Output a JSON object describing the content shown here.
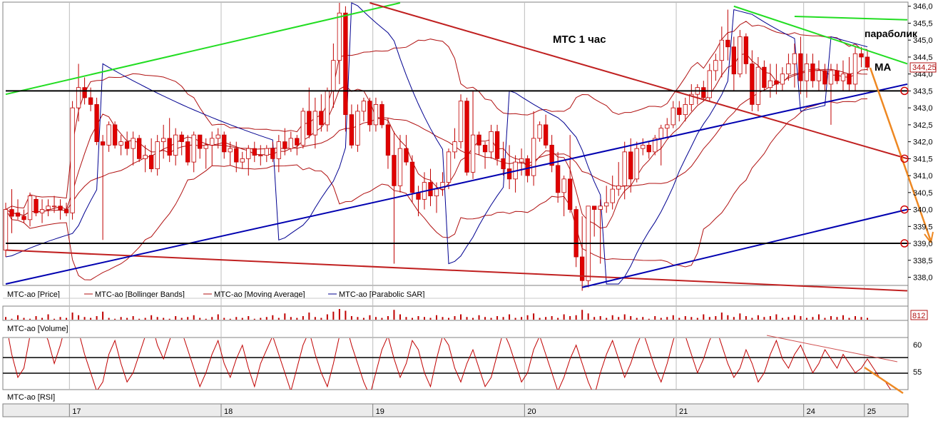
{
  "title": "МТС  1 час",
  "annotations": {
    "parabolic": "параболик",
    "ma": "МА"
  },
  "price_axis": {
    "ticks": [
      "346,0",
      "345,5",
      "345,0",
      "344,5",
      "344,0",
      "343,5",
      "343,0",
      "342,5",
      "342,0",
      "341,5",
      "341,0",
      "340,5",
      "340,0",
      "339,5",
      "339,0",
      "338,5",
      "338,0"
    ],
    "current_label": "344,25"
  },
  "rsi_axis": {
    "ticks": [
      "60",
      "55"
    ]
  },
  "volume_label": "812",
  "legend": {
    "price": "MTC-ao [Price]",
    "bb": "MTC-ao [Bollinger Bands]",
    "ma": "MTC-ao [Moving Average]",
    "sar": "MTC-ao [Parabolic SAR]"
  },
  "panel_labels": {
    "volume": "MTC-ao [Volume]",
    "rsi": "MTC-ao [RSI]"
  },
  "dates": [
    "17",
    "18",
    "19",
    "20",
    "21",
    "24",
    "25"
  ],
  "colors": {
    "bull": "#ffffff",
    "bear": "#e00000",
    "wick": "#c00000",
    "bb": "#b01010",
    "ma": "#b01010",
    "sar": "#000090",
    "green": "#22dd22",
    "red": "#c02020",
    "blue": "#0000b0",
    "orange": "#ee8822"
  },
  "chart_data": {
    "type": "candlestick",
    "title": "МТС  1 час",
    "ylim": [
      337.8,
      346.1
    ],
    "candles": [
      [
        338.8,
        340.2,
        338.6,
        340.0
      ],
      [
        340.0,
        340.6,
        339.3,
        339.8
      ],
      [
        339.9,
        340.3,
        339.7,
        339.8
      ],
      [
        339.8,
        340.0,
        339.6,
        339.7
      ],
      [
        339.7,
        340.5,
        339.5,
        340.4
      ],
      [
        340.3,
        340.4,
        339.8,
        339.9
      ],
      [
        339.9,
        340.3,
        339.6,
        340.0
      ],
      [
        340.0,
        340.3,
        339.8,
        340.1
      ],
      [
        340.1,
        340.4,
        339.9,
        340.1
      ],
      [
        340.1,
        340.3,
        339.7,
        340.0
      ],
      [
        340.0,
        340.2,
        339.8,
        339.9
      ],
      [
        339.9,
        343.2,
        339.7,
        343.0
      ],
      [
        343.0,
        344.3,
        342.6,
        343.6
      ],
      [
        343.6,
        343.9,
        343.1,
        343.3
      ],
      [
        343.3,
        343.6,
        342.9,
        343.1
      ],
      [
        343.1,
        343.3,
        341.9,
        342.0
      ],
      [
        342.0,
        342.2,
        339.1,
        341.9
      ],
      [
        341.9,
        342.6,
        341.7,
        342.5
      ],
      [
        342.5,
        342.6,
        341.8,
        341.9
      ],
      [
        341.9,
        342.2,
        341.6,
        342.0
      ],
      [
        342.0,
        342.3,
        341.6,
        341.8
      ],
      [
        341.8,
        342.3,
        341.3,
        342.1
      ],
      [
        342.1,
        342.2,
        341.4,
        341.5
      ],
      [
        341.5,
        341.9,
        341.1,
        341.6
      ],
      [
        341.6,
        342.1,
        341.1,
        341.2
      ],
      [
        341.2,
        342.2,
        341.0,
        342.0
      ],
      [
        342.0,
        342.5,
        341.5,
        342.1
      ],
      [
        342.1,
        342.7,
        341.4,
        341.6
      ],
      [
        341.6,
        342.4,
        341.3,
        342.2
      ],
      [
        342.2,
        342.3,
        341.6,
        342.0
      ],
      [
        342.0,
        342.2,
        341.3,
        341.4
      ],
      [
        341.4,
        342.3,
        341.1,
        342.2
      ],
      [
        342.2,
        342.2,
        341.5,
        341.8
      ],
      [
        341.8,
        342.1,
        341.2,
        341.9
      ],
      [
        341.9,
        342.3,
        341.3,
        342.1
      ],
      [
        342.1,
        342.4,
        341.8,
        342.2
      ],
      [
        342.2,
        342.3,
        341.5,
        341.7
      ],
      [
        341.7,
        342.0,
        341.3,
        341.8
      ],
      [
        341.8,
        342.0,
        341.1,
        341.4
      ],
      [
        341.4,
        341.7,
        341.2,
        341.5
      ],
      [
        341.5,
        341.9,
        341.0,
        341.8
      ],
      [
        341.8,
        342.0,
        341.4,
        341.6
      ],
      [
        341.6,
        341.9,
        341.3,
        341.6
      ],
      [
        341.6,
        341.9,
        341.4,
        341.8
      ],
      [
        341.8,
        342.0,
        341.4,
        341.5
      ],
      [
        341.5,
        342.2,
        341.1,
        342.0
      ],
      [
        342.0,
        342.4,
        341.6,
        341.8
      ],
      [
        341.8,
        342.3,
        341.7,
        342.1
      ],
      [
        342.1,
        342.2,
        341.6,
        341.9
      ],
      [
        341.9,
        343.0,
        341.8,
        342.9
      ],
      [
        342.9,
        343.6,
        342.1,
        342.2
      ],
      [
        342.2,
        343.3,
        341.8,
        342.9
      ],
      [
        342.9,
        343.4,
        342.3,
        342.5
      ],
      [
        342.5,
        343.6,
        342.3,
        343.5
      ],
      [
        343.5,
        344.9,
        343.0,
        344.4
      ],
      [
        344.4,
        346.1,
        343.7,
        345.8
      ],
      [
        345.8,
        346.0,
        342.3,
        342.8
      ],
      [
        342.8,
        343.1,
        341.8,
        341.9
      ],
      [
        341.9,
        343.1,
        341.7,
        342.9
      ],
      [
        342.9,
        343.3,
        342.6,
        343.2
      ],
      [
        343.2,
        343.3,
        342.3,
        342.5
      ],
      [
        342.5,
        343.3,
        342.3,
        343.1
      ],
      [
        343.1,
        343.2,
        342.4,
        342.5
      ],
      [
        342.5,
        342.7,
        341.2,
        341.6
      ],
      [
        341.6,
        342.3,
        338.4,
        340.7
      ],
      [
        340.7,
        342.2,
        340.5,
        341.8
      ],
      [
        341.8,
        342.2,
        341.3,
        341.4
      ],
      [
        341.4,
        341.6,
        340.2,
        340.5
      ],
      [
        340.5,
        340.7,
        339.8,
        340.3
      ],
      [
        340.3,
        341.1,
        340.0,
        340.8
      ],
      [
        340.8,
        341.2,
        340.1,
        340.4
      ],
      [
        340.4,
        340.8,
        339.9,
        340.6
      ],
      [
        340.6,
        341.1,
        340.4,
        340.8
      ],
      [
        340.8,
        341.8,
        340.6,
        341.7
      ],
      [
        341.7,
        342.4,
        341.5,
        342.0
      ],
      [
        342.0,
        343.4,
        341.8,
        343.2
      ],
      [
        343.2,
        343.3,
        341.0,
        341.1
      ],
      [
        341.1,
        343.5,
        340.9,
        342.2
      ],
      [
        342.2,
        342.3,
        341.6,
        341.9
      ],
      [
        341.9,
        342.0,
        341.2,
        341.7
      ],
      [
        341.7,
        342.5,
        341.5,
        342.3
      ],
      [
        342.3,
        342.5,
        341.3,
        341.5
      ],
      [
        341.5,
        342.0,
        341.0,
        341.2
      ],
      [
        341.2,
        341.9,
        340.6,
        340.9
      ],
      [
        340.9,
        341.6,
        340.5,
        341.4
      ],
      [
        341.4,
        341.8,
        341.0,
        341.5
      ],
      [
        341.5,
        341.6,
        340.8,
        341.0
      ],
      [
        341.0,
        342.9,
        340.7,
        342.1
      ],
      [
        342.1,
        342.6,
        342.0,
        342.5
      ],
      [
        342.5,
        342.8,
        341.8,
        341.9
      ],
      [
        341.9,
        342.2,
        341.1,
        341.3
      ],
      [
        341.3,
        341.7,
        340.2,
        340.5
      ],
      [
        340.5,
        341.0,
        339.8,
        340.9
      ],
      [
        340.9,
        342.2,
        339.9,
        340.0
      ],
      [
        340.0,
        340.1,
        338.3,
        338.6
      ],
      [
        338.6,
        339.8,
        337.6,
        337.9
      ],
      [
        337.9,
        340.1,
        337.7,
        340.1
      ],
      [
        340.1,
        340.1,
        339.2,
        340.0
      ],
      [
        340.0,
        340.3,
        338.4,
        340.1
      ],
      [
        340.1,
        340.7,
        339.9,
        340.2
      ],
      [
        340.2,
        341.0,
        340.0,
        340.6
      ],
      [
        340.6,
        341.4,
        340.4,
        340.7
      ],
      [
        340.7,
        342.0,
        340.3,
        341.7
      ],
      [
        341.7,
        342.1,
        340.5,
        340.9
      ],
      [
        340.9,
        342.0,
        340.8,
        341.8
      ],
      [
        341.8,
        342.1,
        341.6,
        341.9
      ],
      [
        341.9,
        342.0,
        341.5,
        341.7
      ],
      [
        341.7,
        342.2,
        341.6,
        342.1
      ],
      [
        342.1,
        342.5,
        341.3,
        342.4
      ],
      [
        342.4,
        342.7,
        342.1,
        342.5
      ],
      [
        342.5,
        343.2,
        342.4,
        343.0
      ],
      [
        343.0,
        343.2,
        342.6,
        342.8
      ],
      [
        342.8,
        343.3,
        342.6,
        343.1
      ],
      [
        343.1,
        343.7,
        342.9,
        343.4
      ],
      [
        343.4,
        343.7,
        343.1,
        343.6
      ],
      [
        343.6,
        343.8,
        343.2,
        343.3
      ],
      [
        343.3,
        344.3,
        343.2,
        344.1
      ],
      [
        344.1,
        344.6,
        343.8,
        344.4
      ],
      [
        344.4,
        345.4,
        343.9,
        345.0
      ],
      [
        345.0,
        345.9,
        344.4,
        344.8
      ],
      [
        344.8,
        345.1,
        343.5,
        344.0
      ],
      [
        344.0,
        345.3,
        343.9,
        345.1
      ],
      [
        345.1,
        345.2,
        344.0,
        344.3
      ],
      [
        344.3,
        344.7,
        342.9,
        343.1
      ],
      [
        343.1,
        344.5,
        342.9,
        344.2
      ],
      [
        344.2,
        344.4,
        343.5,
        343.6
      ],
      [
        343.6,
        344.3,
        343.3,
        343.8
      ],
      [
        343.8,
        344.3,
        343.4,
        343.7
      ],
      [
        343.7,
        344.2,
        343.5,
        344.0
      ],
      [
        344.0,
        344.6,
        343.8,
        344.3
      ],
      [
        344.3,
        344.9,
        343.6,
        344.6
      ],
      [
        344.6,
        345.1,
        343.4,
        343.8
      ],
      [
        343.8,
        344.6,
        343.3,
        344.3
      ],
      [
        344.3,
        344.6,
        343.6,
        343.8
      ],
      [
        343.8,
        344.4,
        343.5,
        344.1
      ],
      [
        344.1,
        344.3,
        343.5,
        343.7
      ],
      [
        343.7,
        344.3,
        342.5,
        344.1
      ],
      [
        344.1,
        344.3,
        343.7,
        343.8
      ],
      [
        343.8,
        344.4,
        343.5,
        344.0
      ],
      [
        344.0,
        344.5,
        343.5,
        343.7
      ],
      [
        343.7,
        344.8,
        343.5,
        344.6
      ],
      [
        344.6,
        344.8,
        344.2,
        344.5
      ],
      [
        344.5,
        344.7,
        344.1,
        344.2
      ]
    ],
    "trendlines": [
      {
        "color": "green",
        "from": [
          0,
          343.4
        ],
        "to": [
          65,
          346.1
        ]
      },
      {
        "color": "green",
        "from": [
          120,
          346.0
        ],
        "to": [
          172,
          344.3
        ]
      },
      {
        "color": "green",
        "from": [
          130,
          345.7
        ],
        "to": [
          172,
          345.6
        ]
      },
      {
        "color": "red",
        "from": [
          60,
          346.1
        ],
        "to": [
          172,
          341.5
        ]
      },
      {
        "color": "red",
        "from": [
          0,
          338.8
        ],
        "to": [
          172,
          337.6
        ]
      },
      {
        "color": "blue",
        "from": [
          0,
          337.8
        ],
        "to": [
          172,
          343.7
        ]
      },
      {
        "color": "blue",
        "from": [
          95,
          337.7
        ],
        "to": [
          172,
          340.0
        ]
      },
      {
        "color": "black",
        "from": [
          0,
          343.5
        ],
        "to": [
          172,
          343.5
        ]
      },
      {
        "color": "black",
        "from": [
          0,
          339.0
        ],
        "to": [
          172,
          339.0
        ]
      }
    ],
    "rsi": [
      66,
      59,
      54,
      56,
      63,
      69,
      65,
      62,
      57,
      61,
      66,
      68,
      64,
      59,
      55,
      51,
      53,
      59,
      62,
      57,
      53,
      55,
      59,
      63,
      66,
      61,
      58,
      62,
      66,
      64,
      60,
      56,
      52,
      55,
      59,
      62,
      57,
      54,
      58,
      61,
      56,
      52,
      57,
      60,
      63,
      59,
      55,
      51,
      56,
      61,
      64,
      59,
      55,
      52,
      57,
      63,
      66,
      61,
      57,
      53,
      50,
      55,
      60,
      63,
      58,
      54,
      57,
      62,
      60,
      55,
      52,
      58,
      63,
      61,
      56,
      53,
      57,
      60,
      56,
      52,
      54,
      59,
      64,
      61,
      57,
      53,
      55,
      60,
      63,
      59,
      55,
      51,
      54,
      58,
      61,
      57,
      53,
      50,
      55,
      59,
      62,
      58,
      54,
      57,
      61,
      64,
      60,
      56,
      53,
      57,
      62,
      66,
      63,
      59,
      55,
      58,
      62,
      65,
      61,
      57,
      54,
      56,
      60,
      57,
      53,
      55,
      59,
      62,
      58,
      56,
      59,
      61,
      58,
      55,
      57,
      60,
      58,
      56,
      59,
      57,
      55,
      56,
      58,
      56,
      54,
      53,
      51
    ],
    "rsi_ylim": [
      51.5,
      62.5
    ],
    "rsi_levels": [
      58.3,
      54.9
    ],
    "volume": [
      3,
      1,
      5,
      2,
      1,
      4,
      2,
      6,
      1,
      3,
      2,
      8,
      5,
      3,
      2,
      4,
      9,
      2,
      1,
      3,
      2,
      4,
      1,
      2,
      5,
      3,
      2,
      1,
      4,
      2,
      3,
      5,
      2,
      1,
      3,
      6,
      2,
      1,
      3,
      2,
      4,
      1,
      2,
      3,
      5,
      2,
      7,
      3,
      2,
      4,
      8,
      3,
      2,
      6,
      9,
      12,
      10,
      4,
      3,
      2,
      5,
      3,
      2,
      4,
      11,
      6,
      3,
      2,
      4,
      3,
      2,
      5,
      3,
      2,
      4,
      6,
      3,
      2,
      5,
      3,
      2,
      4,
      3,
      6,
      2,
      3,
      5,
      7,
      2,
      3,
      4,
      2,
      6,
      4,
      5,
      11,
      7,
      3,
      4,
      2,
      5,
      3,
      6,
      4,
      2,
      3,
      1,
      4,
      2,
      3,
      5,
      2,
      4,
      3,
      2,
      6,
      3,
      4,
      8,
      5,
      3,
      7,
      4,
      2,
      5,
      3,
      4,
      6,
      2,
      3,
      5,
      4,
      2,
      3,
      6,
      2,
      4,
      3,
      5,
      2,
      4,
      3,
      2
    ]
  }
}
